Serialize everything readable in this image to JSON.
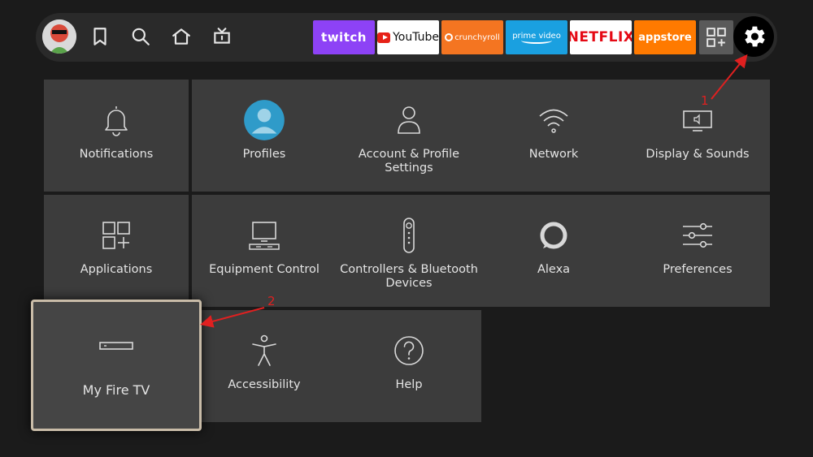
{
  "topbar": {
    "nav_icons": [
      "bookmark-icon",
      "search-icon",
      "home-icon",
      "live-tv-icon"
    ],
    "apps": [
      {
        "id": "twitch",
        "label": "twitch",
        "color": "#8d42f6"
      },
      {
        "id": "youtube",
        "label": "YouTube",
        "color": "#ffffff"
      },
      {
        "id": "crunchyroll",
        "label": "crunchyroll",
        "color": "#f47521"
      },
      {
        "id": "primevideo",
        "label": "prime video",
        "color": "#1aa0e0"
      },
      {
        "id": "netflix",
        "label": "NETFLIX",
        "color": "#ffffff"
      },
      {
        "id": "appstore",
        "label": "appstore",
        "color": "#ff7a00"
      }
    ]
  },
  "settings": {
    "tiles": [
      {
        "label": "Notifications",
        "icon": "bell-icon"
      },
      {
        "label": "Profiles",
        "icon": "profile-avatar-icon"
      },
      {
        "label": "Account & Profile Settings",
        "icon": "person-icon"
      },
      {
        "label": "Network",
        "icon": "wifi-icon"
      },
      {
        "label": "Display & Sounds",
        "icon": "display-speaker-icon"
      },
      {
        "label": "Applications",
        "icon": "apps-grid-icon"
      },
      {
        "label": "Equipment Control",
        "icon": "equipment-icon"
      },
      {
        "label": "Controllers & Bluetooth Devices",
        "icon": "remote-icon"
      },
      {
        "label": "Alexa",
        "icon": "alexa-icon"
      },
      {
        "label": "Preferences",
        "icon": "sliders-icon"
      },
      {
        "label": "My Fire TV",
        "icon": "fire-tv-device-icon",
        "focused": true
      },
      {
        "label": "Accessibility",
        "icon": "accessibility-icon"
      },
      {
        "label": "Help",
        "icon": "help-icon"
      }
    ]
  },
  "annotations": {
    "step1": "1",
    "step2": "2",
    "color": "#e02020"
  }
}
